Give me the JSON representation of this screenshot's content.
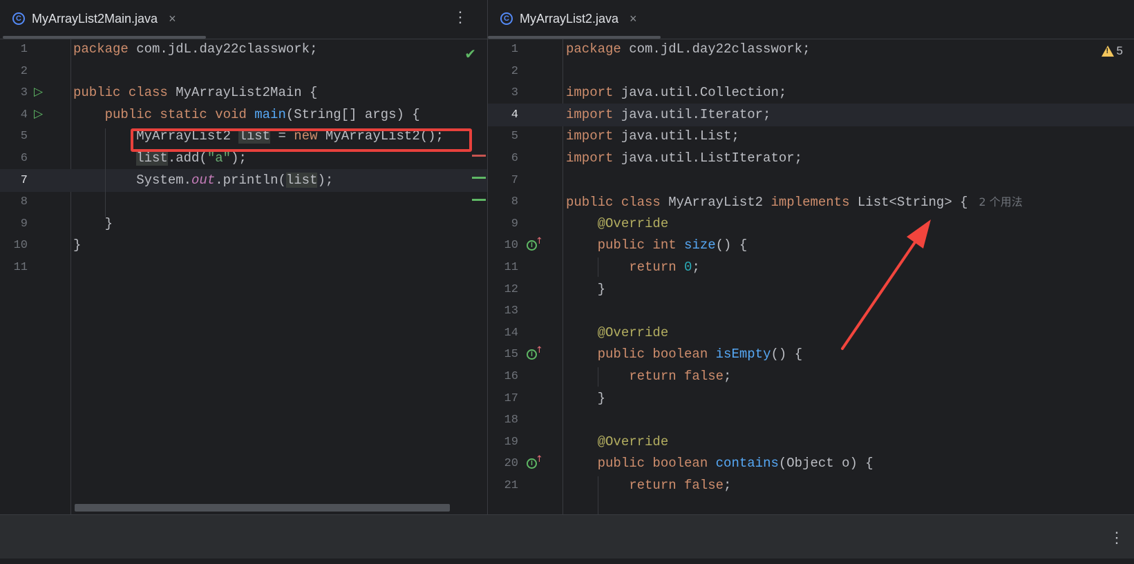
{
  "left_editor": {
    "tab": {
      "title": "MyArrayList2Main.java",
      "close": "×",
      "icon": "class-icon"
    },
    "more": "⋮",
    "status_icon": "check-icon",
    "lines": [
      {
        "n": "1",
        "html": "<span class=\"k\">package</span> com.jdL.day22classwork;"
      },
      {
        "n": "2",
        "html": ""
      },
      {
        "n": "3",
        "html": "<span class=\"k\">public class</span> MyArrayList2Main {",
        "run": true
      },
      {
        "n": "4",
        "html": "    <span class=\"k\">public static void</span> <span class=\"fn\">main</span>(String[] args) {",
        "run": true
      },
      {
        "n": "5",
        "html": "        MyArrayList2 <span class=\"hl\">list</span> = <span class=\"k\">new</span> MyArrayList2();"
      },
      {
        "n": "6",
        "html": "        <span class=\"hl\">list</span>.add(<span class=\"str\">\"a\"</span>);"
      },
      {
        "n": "7",
        "html": "        System.<span class=\"stat\">out</span>.println(<span class=\"hl\">list</span>);",
        "current": true
      },
      {
        "n": "8",
        "html": ""
      },
      {
        "n": "9",
        "html": "    }"
      },
      {
        "n": "10",
        "html": "}"
      },
      {
        "n": "11",
        "html": ""
      }
    ]
  },
  "right_editor": {
    "tab": {
      "title": "MyArrayList2.java",
      "close": "×",
      "icon": "class-icon"
    },
    "warnings": {
      "icon": "warning-icon",
      "count": "5"
    },
    "lines": [
      {
        "n": "1",
        "html": "<span class=\"k\">package</span> com.jdL.day22classwork;"
      },
      {
        "n": "2",
        "html": ""
      },
      {
        "n": "3",
        "html": "<span class=\"k\">import</span> java.util.Collection;"
      },
      {
        "n": "4",
        "html": "<span class=\"k\">import</span> java.util.Iterator;",
        "current": true
      },
      {
        "n": "5",
        "html": "<span class=\"k\">import</span> java.util.List;"
      },
      {
        "n": "6",
        "html": "<span class=\"k\">import</span> java.util.ListIterator;"
      },
      {
        "n": "7",
        "html": ""
      },
      {
        "n": "8",
        "html": "<span class=\"k\">public class</span> MyArrayList2 <span class=\"k\">implements</span> List&lt;String&gt; {<span class=\"hint\">2 个用法</span>"
      },
      {
        "n": "9",
        "html": "    <span class=\"ann\">@Override</span>"
      },
      {
        "n": "10",
        "html": "    <span class=\"k\">public int</span> <span class=\"fn\">size</span>() {",
        "impl": true
      },
      {
        "n": "11",
        "html": "        <span class=\"k\">return</span> <span class=\"num\">0</span>;"
      },
      {
        "n": "12",
        "html": "    }"
      },
      {
        "n": "13",
        "html": ""
      },
      {
        "n": "14",
        "html": "    <span class=\"ann\">@Override</span>"
      },
      {
        "n": "15",
        "html": "    <span class=\"k\">public boolean</span> <span class=\"fn\">isEmpty</span>() {",
        "impl": true
      },
      {
        "n": "16",
        "html": "        <span class=\"k\">return false</span>;"
      },
      {
        "n": "17",
        "html": "    }"
      },
      {
        "n": "18",
        "html": ""
      },
      {
        "n": "19",
        "html": "    <span class=\"ann\">@Override</span>"
      },
      {
        "n": "20",
        "html": "    <span class=\"k\">public boolean</span> <span class=\"fn\">contains</span>(Object o) {",
        "impl": true
      },
      {
        "n": "21",
        "html": "        <span class=\"k\">return false</span>;"
      }
    ]
  },
  "bottom_panel": {
    "more": "⋮"
  }
}
